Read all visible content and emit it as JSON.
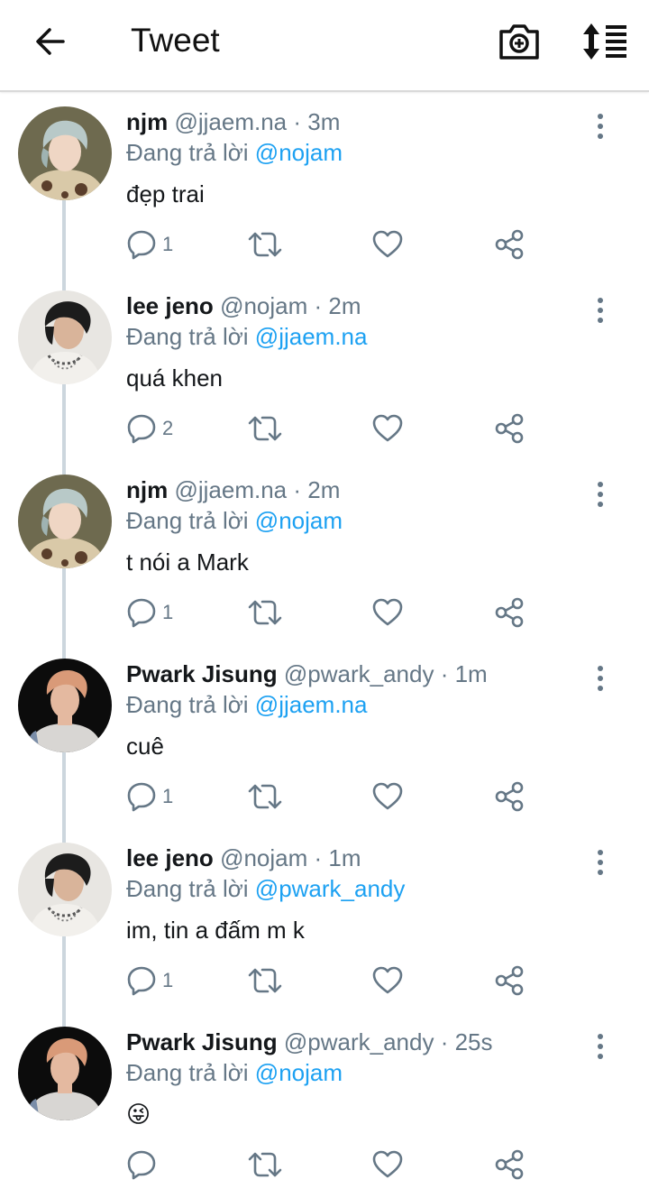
{
  "header": {
    "back_icon": "arrow-left-icon",
    "title": "Tweet",
    "camera_icon": "camera-add-icon",
    "sort_icon": "sort-icon"
  },
  "colors": {
    "name": "#14171a",
    "secondary": "#657786",
    "mention": "#1da1f2",
    "thread_line": "#ccd6dd"
  },
  "reply_prefix": "Đang trả lời",
  "tweets": [
    {
      "name": "njm",
      "handle": "@jjaem.na",
      "time": "3m",
      "reply_to": "@nojam",
      "text": "đẹp trai",
      "reply_count": "1"
    },
    {
      "name": "lee jeno",
      "handle": "@nojam",
      "time": "2m",
      "reply_to": "@jjaem.na",
      "text": "quá khen",
      "reply_count": "2"
    },
    {
      "name": "njm",
      "handle": "@jjaem.na",
      "time": "2m",
      "reply_to": "@nojam",
      "text": "t nói a Mark",
      "reply_count": "1"
    },
    {
      "name": "Pwark Jisung",
      "handle": "@pwark_andy",
      "time": "1m",
      "reply_to": "@jjaem.na",
      "text": "cuê",
      "reply_count": "1"
    },
    {
      "name": "lee jeno",
      "handle": "@nojam",
      "time": "1m",
      "reply_to": "@pwark_andy",
      "text": "im, tin a đấm m k",
      "reply_count": "1"
    },
    {
      "name": "Pwark Jisung",
      "handle": "@pwark_andy",
      "time": "25s",
      "reply_to": "@nojam",
      "text": "😜",
      "reply_count": ""
    }
  ]
}
